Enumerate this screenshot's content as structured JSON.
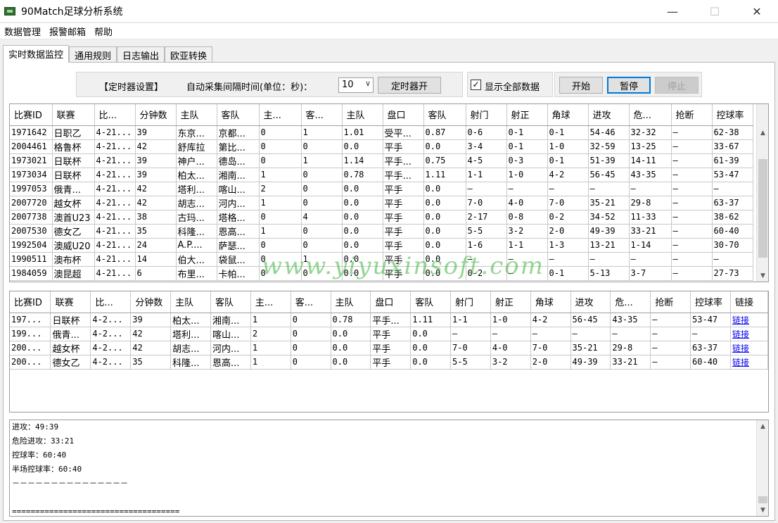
{
  "window": {
    "title": "90Match足球分析系统",
    "min": "—",
    "max": "☐",
    "close": "✕"
  },
  "menu": [
    "数据管理",
    "报警邮箱",
    "帮助"
  ],
  "tabs": [
    "实时数据监控",
    "通用规则",
    "日志输出",
    "欧亚转换"
  ],
  "timer": {
    "title": "【定时器设置】",
    "interval_label": "自动采集间隔时间(单位：秒)：",
    "interval_value": "10",
    "button": "定时器开"
  },
  "show_all_label": "显示全部数据",
  "controls": {
    "start": "开始",
    "pause": "暂停",
    "stop": "停止"
  },
  "main_table": {
    "headers": [
      "比赛ID",
      "联赛",
      "比...",
      "分钟数",
      "主队",
      "客队",
      "主...",
      "客...",
      "主队",
      "盘口",
      "客队",
      "射门",
      "射正",
      "角球",
      "进攻",
      "危...",
      "抢断",
      "控球率"
    ],
    "rows": [
      [
        "1971642",
        "日职乙",
        "4-21...",
        "39",
        "东京...",
        "京都...",
        "0",
        "1",
        "1.01",
        "受平...",
        "0.87",
        "0-6",
        "0-1",
        "0-1",
        "54-46",
        "32-32",
        "–",
        "62-38"
      ],
      [
        "2004461",
        "格鲁杯",
        "4-21...",
        "42",
        "舒库拉",
        "第比...",
        "0",
        "0",
        "0.0",
        "平手",
        "0.0",
        "3-4",
        "0-1",
        "1-0",
        "32-59",
        "13-25",
        "–",
        "33-67"
      ],
      [
        "1973021",
        "日联杯",
        "4-21...",
        "39",
        "神户...",
        "德岛...",
        "0",
        "1",
        "1.14",
        "平手...",
        "0.75",
        "4-5",
        "0-3",
        "0-1",
        "51-39",
        "14-11",
        "–",
        "61-39"
      ],
      [
        "1973034",
        "日联杯",
        "4-21...",
        "39",
        "柏太...",
        "湘南...",
        "1",
        "0",
        "0.78",
        "平手...",
        "1.11",
        "1-1",
        "1-0",
        "4-2",
        "56-45",
        "43-35",
        "–",
        "53-47"
      ],
      [
        "1997053",
        "俄青...",
        "4-21...",
        "42",
        "塔利...",
        "喀山...",
        "2",
        "0",
        "0.0",
        "平手",
        "0.0",
        "–",
        "–",
        "–",
        "–",
        "–",
        "–",
        "–"
      ],
      [
        "2007720",
        "越女杯",
        "4-21...",
        "42",
        "胡志...",
        "河内...",
        "1",
        "0",
        "0.0",
        "平手",
        "0.0",
        "7-0",
        "4-0",
        "7-0",
        "35-21",
        "29-8",
        "–",
        "63-37"
      ],
      [
        "2007738",
        "澳首U23",
        "4-21...",
        "38",
        "古玛...",
        "塔格...",
        "0",
        "4",
        "0.0",
        "平手",
        "0.0",
        "2-17",
        "0-8",
        "0-2",
        "34-52",
        "11-33",
        "–",
        "38-62"
      ],
      [
        "2007530",
        "德女乙",
        "4-21...",
        "35",
        "科隆...",
        "恩高...",
        "1",
        "0",
        "0.0",
        "平手",
        "0.0",
        "5-5",
        "3-2",
        "2-0",
        "49-39",
        "33-21",
        "–",
        "60-40"
      ],
      [
        "1992504",
        "澳威U20",
        "4-21...",
        "24",
        "A.P....",
        "萨瑟...",
        "0",
        "0",
        "0.0",
        "平手",
        "0.0",
        "1-6",
        "1-1",
        "1-3",
        "13-21",
        "1-14",
        "–",
        "30-70"
      ],
      [
        "1990511",
        "澳布杯",
        "4-21...",
        "14",
        "伯大...",
        "袋鼠...",
        "0",
        "1",
        "0.0",
        "平手",
        "0.0",
        "–",
        "–",
        "–",
        "–",
        "–",
        "–",
        "–"
      ],
      [
        "1984059",
        "澳昆超",
        "4-21...",
        "6",
        "布里...",
        "卡帕...",
        "0",
        "0",
        "0.0",
        "平手",
        "0.0",
        "0-2",
        "–",
        "0-1",
        "5-13",
        "3-7",
        "–",
        "27-73"
      ]
    ]
  },
  "alert_table": {
    "headers": [
      "比赛ID",
      "联赛",
      "比...",
      "分钟数",
      "主队",
      "客队",
      "主...",
      "客...",
      "主队",
      "盘口",
      "客队",
      "射门",
      "射正",
      "角球",
      "进攻",
      "危...",
      "抢断",
      "控球率",
      "链接"
    ],
    "rows": [
      [
        "197...",
        "日联杯",
        "4-2...",
        "39",
        "柏太...",
        "湘南...",
        "1",
        "0",
        "0.78",
        "平手...",
        "1.11",
        "1-1",
        "1-0",
        "4-2",
        "56-45",
        "43-35",
        "–",
        "53-47",
        "链接"
      ],
      [
        "199...",
        "俄青...",
        "4-2...",
        "42",
        "塔利...",
        "喀山...",
        "2",
        "0",
        "0.0",
        "平手",
        "0.0",
        "–",
        "–",
        "–",
        "–",
        "–",
        "–",
        "–",
        "链接"
      ],
      [
        "200...",
        "越女杯",
        "4-2...",
        "42",
        "胡志...",
        "河内...",
        "1",
        "0",
        "0.0",
        "平手",
        "0.0",
        "7-0",
        "4-0",
        "7-0",
        "35-21",
        "29-8",
        "–",
        "63-37",
        "链接"
      ],
      [
        "200...",
        "德女乙",
        "4-2...",
        "35",
        "科隆...",
        "恩高...",
        "1",
        "0",
        "0.0",
        "平手",
        "0.0",
        "5-5",
        "3-2",
        "2-0",
        "49-39",
        "33-21",
        "–",
        "60-40",
        "链接"
      ]
    ]
  },
  "watermark": "www.yiyuxinsoft.com",
  "log_lines": [
    "进攻：49:39",
    "危险进攻：33:21",
    "控球率：60:40",
    "半场控球率：60:40",
    "－－－－－－－－－－－－－－－",
    "",
    "===================================="
  ],
  "scroll_up": "▲",
  "scroll_down": "▼"
}
